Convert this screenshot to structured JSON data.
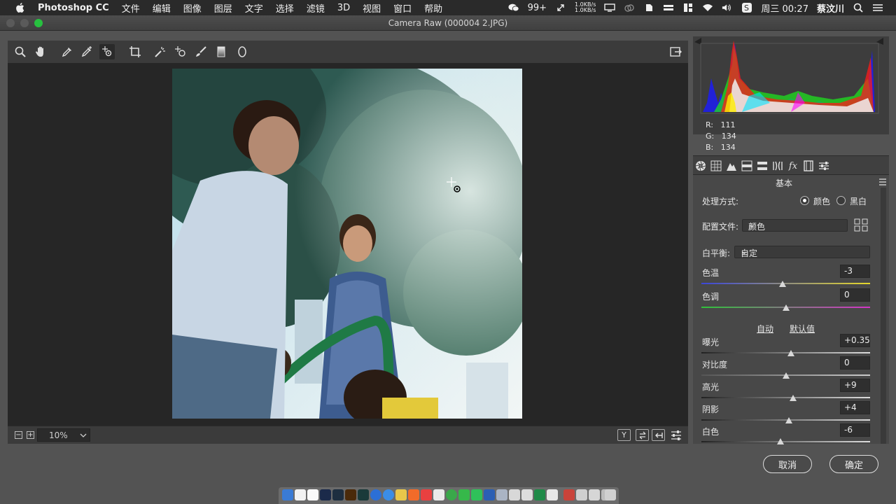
{
  "menubar": {
    "app_name": "Photoshop CC",
    "menus": [
      "文件",
      "编辑",
      "图像",
      "图层",
      "文字",
      "选择",
      "滤镜",
      "3D",
      "视图",
      "窗口",
      "帮助"
    ],
    "wechat_badge": "99+",
    "net_up": "1.0KB/s",
    "net_down": "1.0KB/s",
    "datetime": "周三 00:27",
    "user": "蔡汶川"
  },
  "window": {
    "title": "Camera Raw (000004 2.JPG)"
  },
  "tools": [
    "zoom-tool",
    "hand-tool",
    "white-balance-tool",
    "color-sampler-tool",
    "targeted-adjustment-tool",
    "crop-tool",
    "straighten-tool",
    "spot-removal-tool",
    "red-eye-tool",
    "adjustment-brush-tool",
    "graduated-filter-tool",
    "radial-filter-tool"
  ],
  "preview": {
    "zoom": "10%"
  },
  "histogram": {
    "r_label": "R:",
    "r": "111",
    "g_label": "G:",
    "g": "134",
    "b_label": "B:",
    "b": "134"
  },
  "panel": {
    "title": "基本",
    "treatment_label": "处理方式:",
    "treatment_color": "颜色",
    "treatment_bw": "黑白",
    "treatment_selected": "color",
    "profile_label": "配置文件:",
    "profile_value": "颜色",
    "wb_label": "白平衡:",
    "wb_value": "自定",
    "auto_label": "自动",
    "default_label": "默认值",
    "sliders": [
      {
        "label": "色温",
        "value": "-3",
        "pos": 0.48
      },
      {
        "label": "色调",
        "value": "0",
        "pos": 0.5
      },
      {
        "label": "曝光",
        "value": "+0.35",
        "pos": 0.53
      },
      {
        "label": "对比度",
        "value": "0",
        "pos": 0.5
      },
      {
        "label": "高光",
        "value": "+9",
        "pos": 0.545
      },
      {
        "label": "阴影",
        "value": "+4",
        "pos": 0.52
      },
      {
        "label": "白色",
        "value": "-6",
        "pos": 0.47
      }
    ]
  },
  "buttons": {
    "cancel": "取消",
    "ok": "确定"
  },
  "colors": {
    "accent": "#2a8c3f",
    "panel_bg": "#484848"
  }
}
